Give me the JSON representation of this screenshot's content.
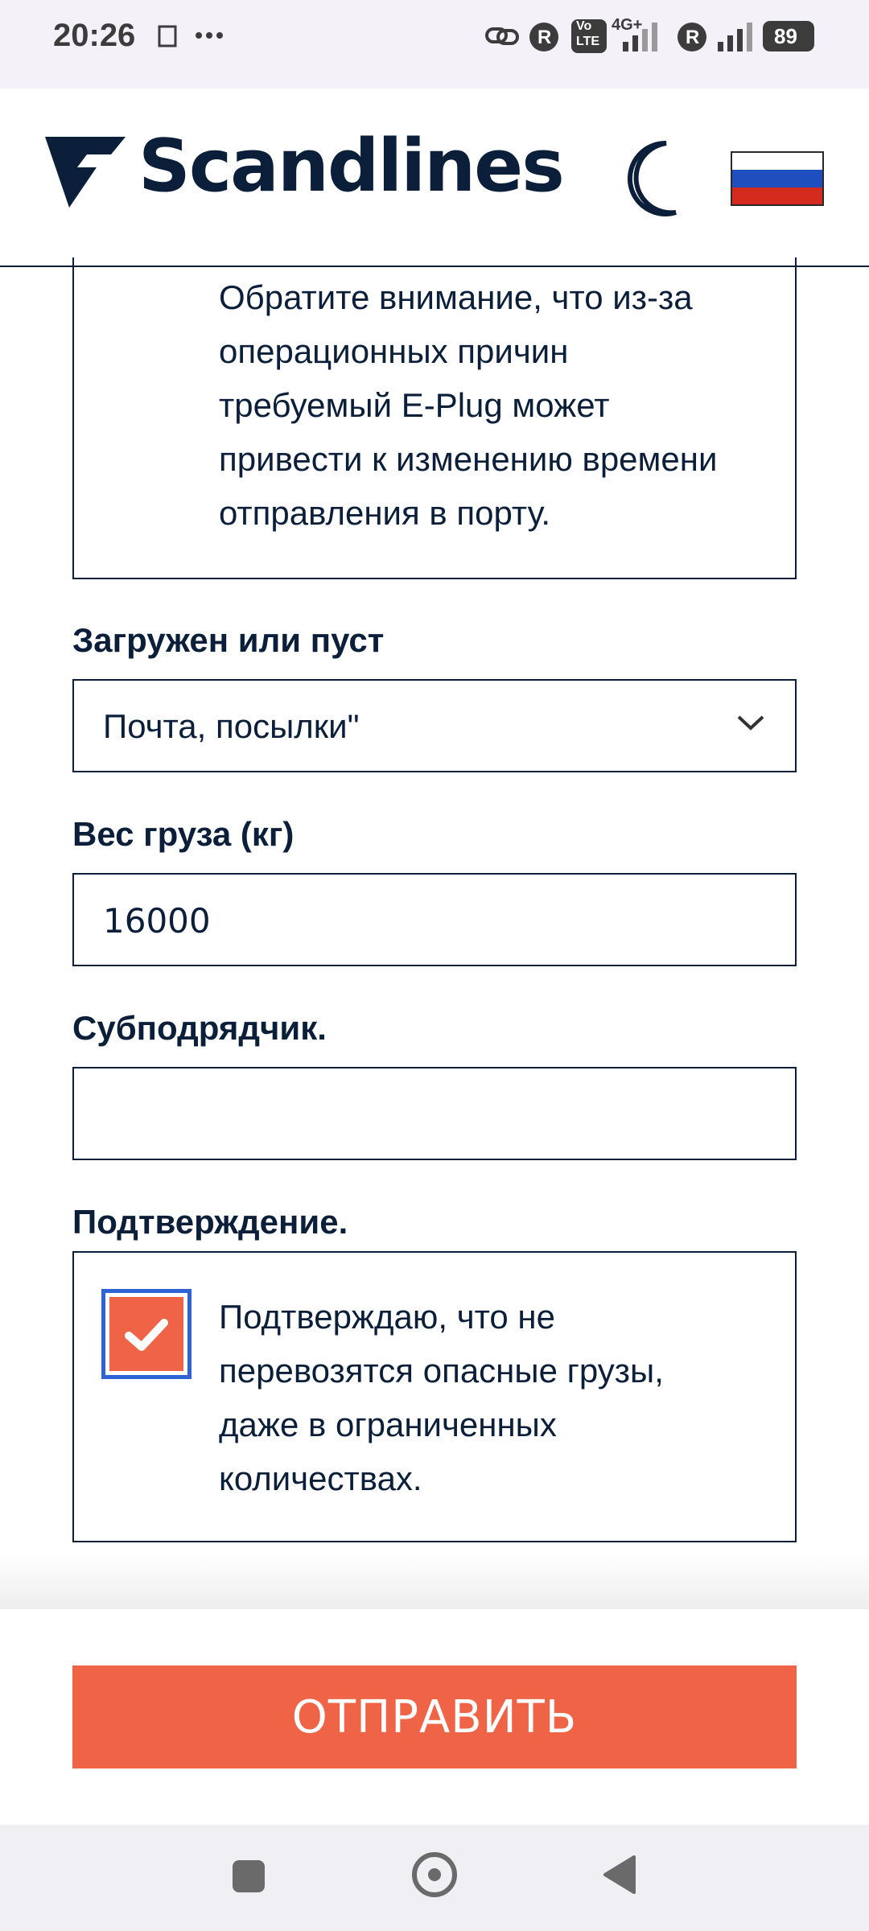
{
  "status_bar": {
    "time": "20:26",
    "network": "4G+",
    "volte_top": "Vo",
    "volte_bottom": "LTE",
    "battery": "89",
    "r_badge": "R"
  },
  "header": {
    "logo_text": "Scandlines",
    "theme_icon": "moon-icon",
    "language_flag": "russian-flag-icon"
  },
  "notice": {
    "lines": [
      "Обратите внимание, что из-за",
      "операционных причин",
      "требуемый E-Plug может",
      "привести к изменению времени",
      "отправления в порту."
    ]
  },
  "form": {
    "load_status": {
      "label": "Загружен или пуст",
      "selected": "Почта, посылки\""
    },
    "cargo_weight": {
      "label": "Вес груза (кг)",
      "value": "16000"
    },
    "subcontractor": {
      "label": "Субподрядчик.",
      "value": ""
    },
    "confirmation": {
      "label": "Подтверждение.",
      "checked": true,
      "lines": [
        "Подтверждаю, что не",
        "перевозятся опасные грузы,",
        "даже в ограниченных",
        "количествах."
      ]
    }
  },
  "submit_label": "ОТПРАВИТЬ",
  "colors": {
    "accent": "#ef6347",
    "text": "#0b1f3a",
    "checkbox_border": "#2e63d6"
  }
}
